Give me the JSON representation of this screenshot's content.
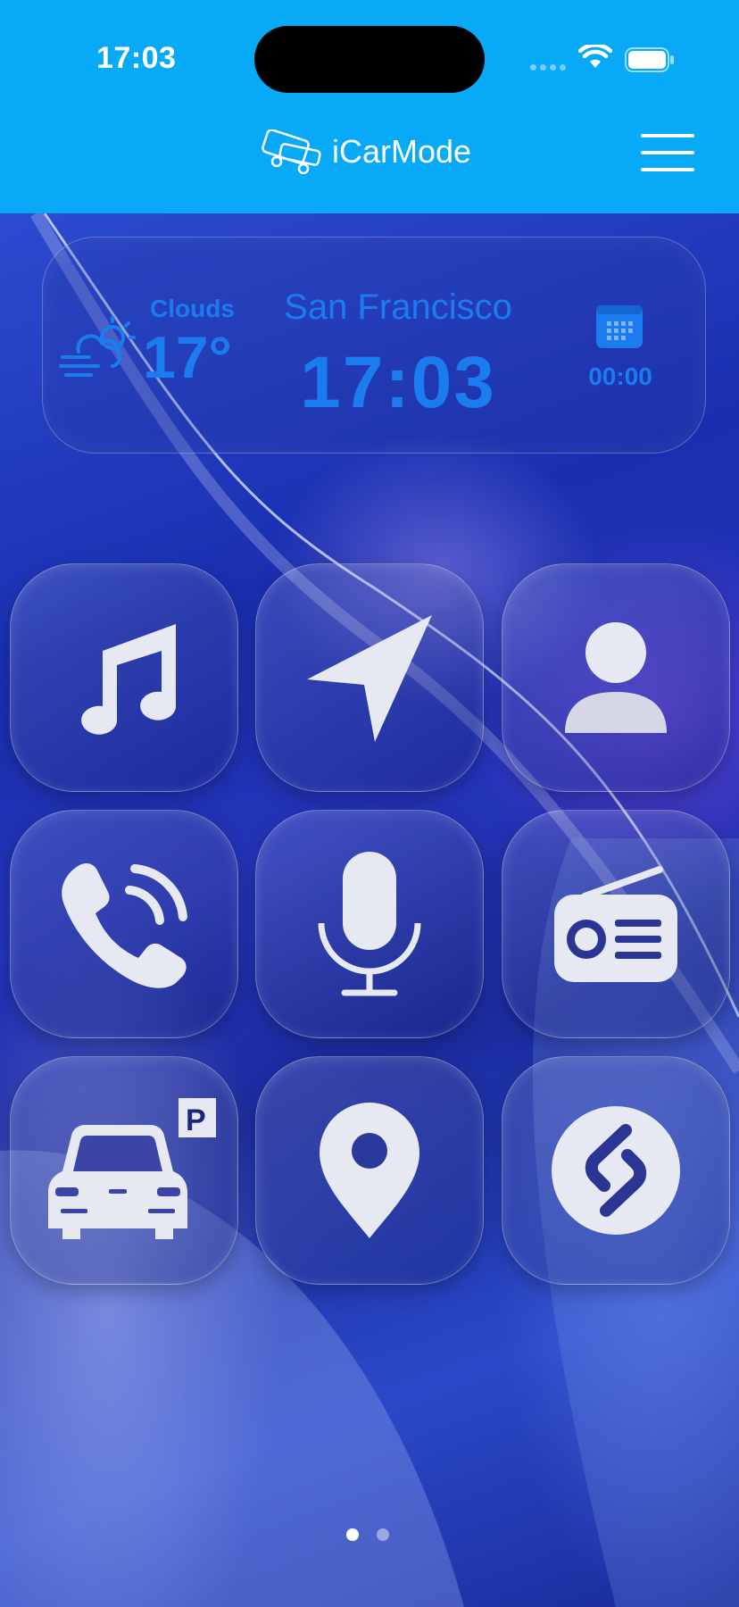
{
  "status_bar": {
    "time": "17:03"
  },
  "header": {
    "app_name": "iCarMode"
  },
  "widget": {
    "weather_condition": "Clouds",
    "temperature": "17°",
    "city": "San Francisco",
    "clock": "17:03",
    "timer": "00:00"
  },
  "tiles": [
    {
      "name": "music",
      "icon": "music-note-icon"
    },
    {
      "name": "navigation",
      "icon": "navigation-arrow-icon"
    },
    {
      "name": "contacts",
      "icon": "person-icon"
    },
    {
      "name": "phone",
      "icon": "phone-icon"
    },
    {
      "name": "voice",
      "icon": "microphone-icon"
    },
    {
      "name": "radio",
      "icon": "radio-icon"
    },
    {
      "name": "parking",
      "icon": "car-parking-icon"
    },
    {
      "name": "location",
      "icon": "location-pin-icon"
    },
    {
      "name": "shazam",
      "icon": "shazam-icon"
    }
  ],
  "pagination": {
    "current_page": 1,
    "total_pages": 2
  },
  "colors": {
    "header_bg": "#08aaf8",
    "widget_text": "#1b7cf0",
    "icon_fill": "#e6e8f2"
  }
}
